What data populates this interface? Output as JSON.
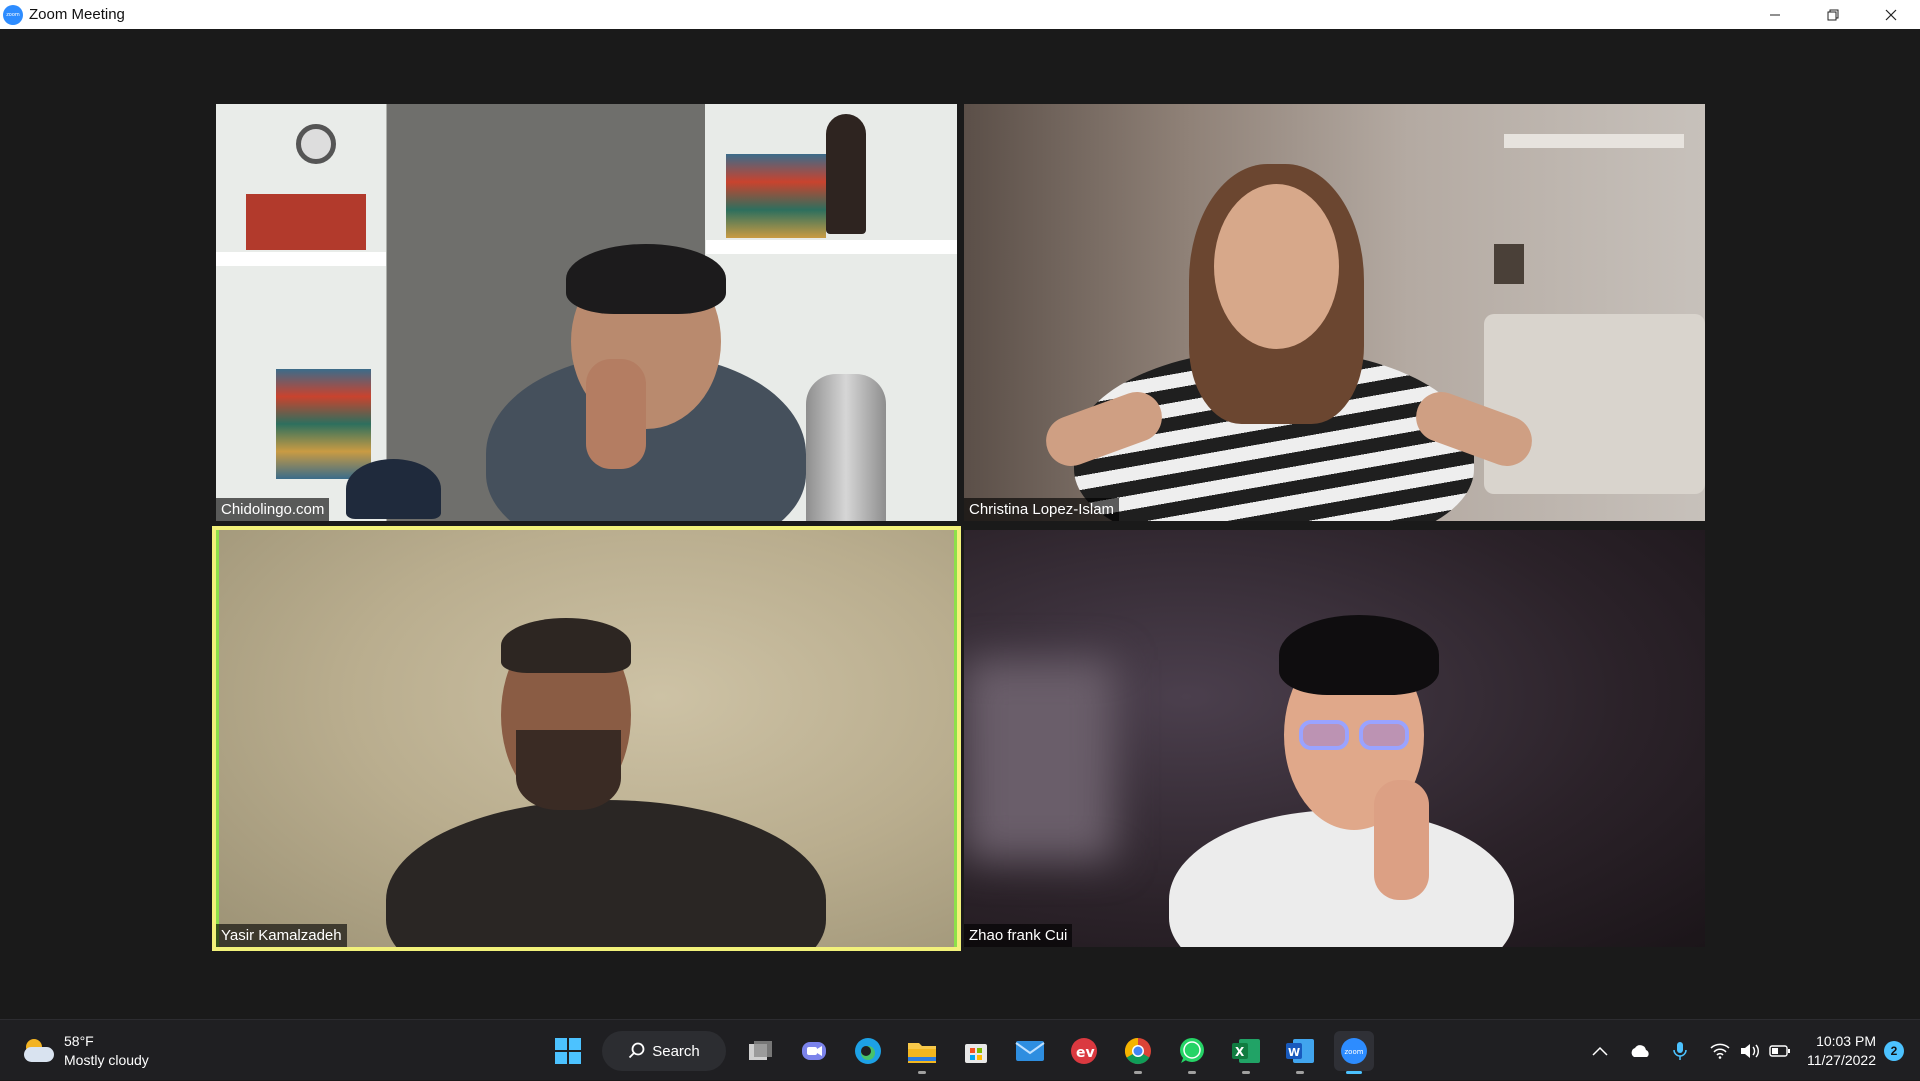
{
  "window": {
    "title": "Zoom Meeting",
    "app_icon_text": "zoom",
    "minimize_icon": "minimize-icon",
    "restore_icon": "restore-icon",
    "close_icon": "close-icon"
  },
  "participants": [
    {
      "name": "Chidolingo.com",
      "active_speaker": false
    },
    {
      "name": "Christina Lopez-Islam",
      "active_speaker": false
    },
    {
      "name": "Yasir Kamalzadeh",
      "active_speaker": true
    },
    {
      "name": "Zhao frank Cui",
      "active_speaker": false
    }
  ],
  "taskbar": {
    "weather": {
      "temperature": "58°F",
      "condition": "Mostly cloudy"
    },
    "search_label": "Search",
    "apps": [
      "start",
      "search",
      "task-view",
      "teams-chat",
      "edge",
      "file-explorer",
      "microsoft-store",
      "mail",
      "expressvpn",
      "chrome",
      "whatsapp",
      "excel",
      "word",
      "zoom"
    ],
    "clock": {
      "time": "10:03 PM",
      "date": "11/27/2022"
    },
    "notification_count": "2"
  },
  "colors": {
    "active_speaker_border": "#f2f17a",
    "taskbar_bg": "#1f1f22",
    "accent": "#4cc2ff",
    "zoom_blue": "#2d8cff"
  }
}
